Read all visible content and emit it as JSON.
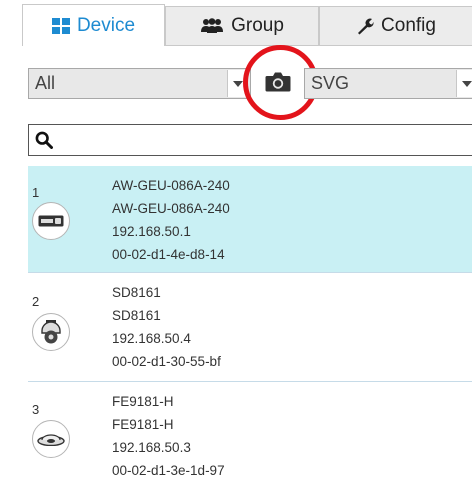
{
  "tabs": [
    {
      "label": "Device",
      "icon": "grid-icon",
      "active": true
    },
    {
      "label": "Group",
      "icon": "users-icon",
      "active": false
    },
    {
      "label": "Config",
      "icon": "wrench-icon",
      "active": false
    }
  ],
  "filters": {
    "type_value": "All",
    "format_value": "SVG"
  },
  "search": {
    "value": "",
    "placeholder": ""
  },
  "devices": [
    {
      "index": "1",
      "name": "AW-GEU-086A-240",
      "model": "AW-GEU-086A-240",
      "ip": "192.168.50.1",
      "mac": "00-02-d1-4e-d8-14",
      "icon": "switch-icon",
      "selected": true
    },
    {
      "index": "2",
      "name": "SD8161",
      "model": "SD8161",
      "ip": "192.168.50.4",
      "mac": "00-02-d1-30-55-bf",
      "icon": "ptz-camera-icon",
      "selected": false
    },
    {
      "index": "3",
      "name": "FE9181-H",
      "model": "FE9181-H",
      "ip": "192.168.50.3",
      "mac": "00-02-d1-3e-1d-97",
      "icon": "fisheye-camera-icon",
      "selected": false
    }
  ],
  "colors": {
    "accent": "#1e8bd1",
    "selected_row": "#c9f0f4",
    "highlight_circle": "#e3141b"
  }
}
